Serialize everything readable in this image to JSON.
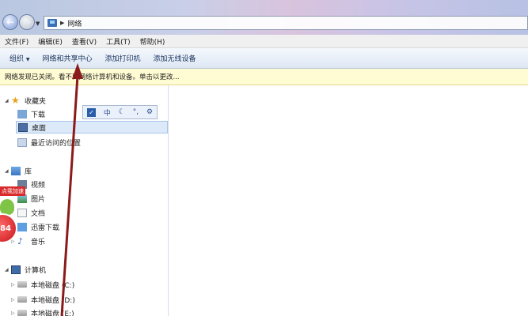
{
  "address": {
    "path": "网络"
  },
  "menu": [
    "文件(F)",
    "编辑(E)",
    "查看(V)",
    "工具(T)",
    "帮助(H)"
  ],
  "toolbar": {
    "organize": "组织",
    "network_center": "网络和共享中心",
    "add_printer": "添加打印机",
    "add_wireless": "添加无线设备"
  },
  "infobar": {
    "text": "网络发现已关闭。看不到网络计算机和设备。单击以更改..."
  },
  "ime": {
    "mode": "中",
    "icons": [
      "check-icon",
      "moon-icon",
      "dots-icon",
      "gear-icon"
    ]
  },
  "sidebar": {
    "favorites": "收藏夹",
    "download": "下载",
    "desktop": "桌面",
    "recent": "最近访问的位置",
    "library": "库",
    "video": "视频",
    "pictures": "图片",
    "docs": "文档",
    "thunder": "迅雷下载",
    "music": "音乐",
    "computer": "计算机",
    "disk_c": "本地磁盘 (C:)",
    "disk_d": "本地磁盘 (D:)",
    "disk_e": "本地磁盘 (E:)"
  },
  "overlay": {
    "ad_label": "点我加速",
    "ad_number": "84"
  },
  "colors": {
    "arrow": "#8b1a1a",
    "selected": "#dbe9f8",
    "infobar": "#fffbd2"
  }
}
